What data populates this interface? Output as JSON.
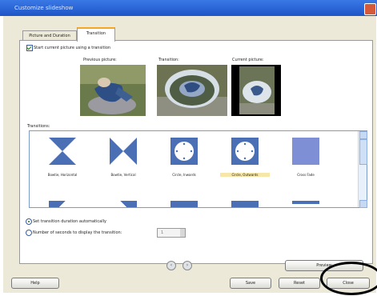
{
  "window": {
    "title": "Customize slideshow"
  },
  "tabs": [
    {
      "label": "Picture and Duration"
    },
    {
      "label": "Transition"
    }
  ],
  "transition_tab": {
    "start_checkbox": {
      "label": "Start current picture using a transition",
      "checked": true
    },
    "previews": [
      {
        "label": "Previous picture:"
      },
      {
        "label": "Transition:"
      },
      {
        "label": "Current picture:"
      }
    ],
    "transitions_label": "Transitions:",
    "transitions": [
      {
        "name": "Bowtie, Horizontal",
        "icon": "bowtie-horizontal-icon"
      },
      {
        "name": "Bowtie, Vertical",
        "icon": "bowtie-vertical-icon"
      },
      {
        "name": "Circle, Inwards",
        "icon": "circle-inwards-icon"
      },
      {
        "name": "Circle, Outwards",
        "icon": "circle-outwards-icon",
        "selected": true
      },
      {
        "name": "Cross Fade",
        "icon": "cross-fade-icon"
      }
    ],
    "radio_auto": {
      "label": "Set transition duration automatically",
      "selected": true
    },
    "radio_manual": {
      "label": "Number of seconds to display the transition:",
      "selected": false,
      "value": "1"
    }
  },
  "buttons": {
    "preview": "Preview",
    "help": "Help",
    "save": "Save",
    "reset": "Reset",
    "close": "Close"
  },
  "colors": {
    "titlebar": "#2a63d6",
    "accent_tab": "#f5a623",
    "transition_icon": "#4a6fb5"
  }
}
